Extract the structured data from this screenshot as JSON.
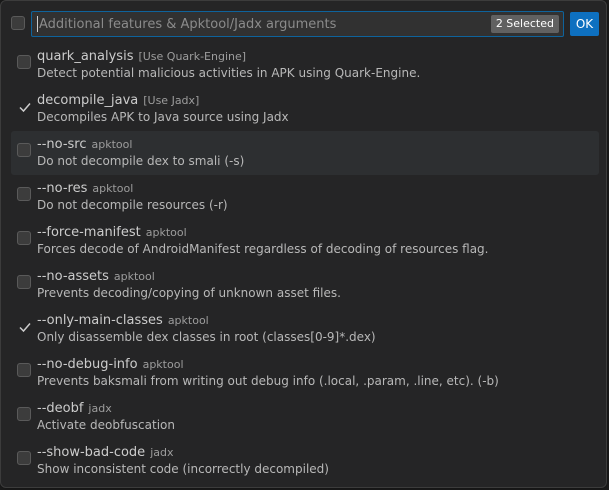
{
  "picker": {
    "input_placeholder": "Additional features & Apktool/Jadx arguments",
    "input_value": "",
    "selected_count": "2 Selected",
    "ok_label": "OK"
  },
  "colors": {
    "accent": "#0e70c0",
    "background": "#252526",
    "focused_row": "#2d2f31"
  },
  "items": [
    {
      "label": "quark_analysis",
      "description": "[Use Quark-Engine]",
      "detail": "Detect potential malicious activities in APK using Quark-Engine.",
      "checked": false
    },
    {
      "label": "decompile_java",
      "description": "[Use Jadx]",
      "detail": "Decompiles APK to Java source using Jadx",
      "checked": true
    },
    {
      "label": "--no-src",
      "description": "apktool",
      "detail": "Do not decompile dex to smali (-s)",
      "checked": false,
      "focused": true
    },
    {
      "label": "--no-res",
      "description": "apktool",
      "detail": "Do not decompile resources (-r)",
      "checked": false
    },
    {
      "label": "--force-manifest",
      "description": "apktool",
      "detail": "Forces decode of AndroidManifest regardless of decoding of resources flag.",
      "checked": false
    },
    {
      "label": "--no-assets",
      "description": "apktool",
      "detail": "Prevents decoding/copying of unknown asset files.",
      "checked": false
    },
    {
      "label": "--only-main-classes",
      "description": "apktool",
      "detail": "Only disassemble dex classes in root (classes[0-9]*.dex)",
      "checked": true
    },
    {
      "label": "--no-debug-info",
      "description": "apktool",
      "detail": "Prevents baksmali from writing out debug info (.local, .param, .line, etc). (-b)",
      "checked": false
    },
    {
      "label": "--deobf",
      "description": "jadx",
      "detail": "Activate deobfuscation",
      "checked": false
    },
    {
      "label": "--show-bad-code",
      "description": "jadx",
      "detail": "Show inconsistent code (incorrectly decompiled)",
      "checked": false
    }
  ]
}
